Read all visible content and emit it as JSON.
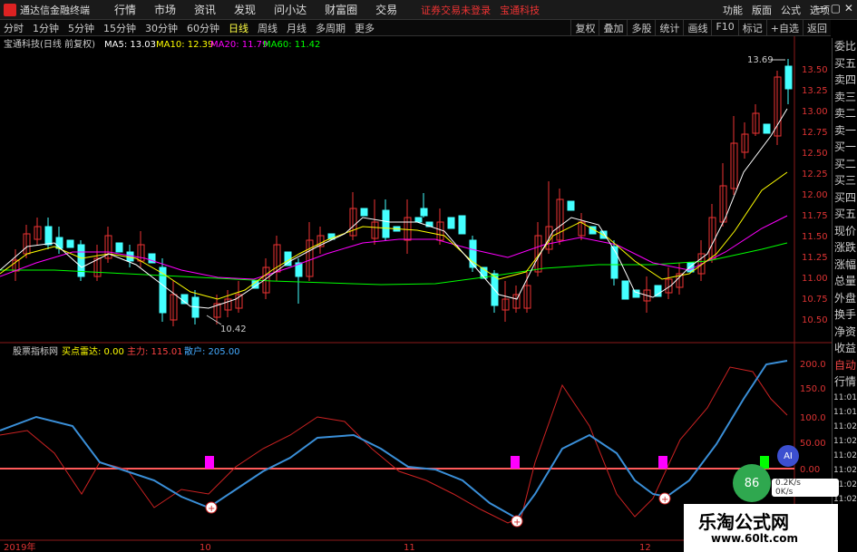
{
  "menu": {
    "app_title": "通达信金融终端",
    "items": [
      "行情",
      "市场",
      "资讯",
      "发现",
      "问小达",
      "财富圈",
      "交易"
    ],
    "status_login": "证券交易未登录",
    "status_stock": "宝通科技",
    "right_items": [
      "功能",
      "版面",
      "公式",
      "选项"
    ]
  },
  "toolbar": {
    "periods": [
      "分时",
      "1分钟",
      "5分钟",
      "15分钟",
      "30分钟",
      "60分钟",
      "日线",
      "周线",
      "月线",
      "多周期",
      "更多"
    ],
    "active": "日线",
    "right": [
      "复权",
      "叠加",
      "多股",
      "统计",
      "画线",
      "F10",
      "标记",
      "+自选",
      "返回"
    ]
  },
  "main_header": {
    "title": "宝通科技(日线 前复权)",
    "ma5": "MA5: 13.03",
    "ma10": "MA10: 12.39",
    "ma20": "MA20: 11.79",
    "ma60": "MA60: 11.42",
    "colors": {
      "ma5": "#ffffff",
      "ma10": "#ffff00",
      "ma20": "#ff00ff",
      "ma60": "#00ff00"
    }
  },
  "price_axis": [
    "13.50",
    "13.25",
    "13.00",
    "12.75",
    "12.50",
    "12.25",
    "12.00",
    "11.75",
    "11.50",
    "11.25",
    "11.00",
    "10.75",
    "10.50"
  ],
  "annotations": {
    "high": "13.69",
    "low": "10.42"
  },
  "indicator_header": {
    "name": "股票指标网",
    "line1": "买点雷达: 0.00",
    "line2": "主力: 115.01",
    "line3": "散户: 205.00"
  },
  "indicator_axis": [
    "200.0",
    "150.0",
    "100.0",
    "50.00",
    "0.00"
  ],
  "time_axis": [
    "2019年",
    "10",
    "11",
    "12"
  ],
  "side_panel": [
    "委比",
    "买五",
    "卖四",
    "卖三",
    "卖二",
    "卖一",
    "买一",
    "买二",
    "买三",
    "买四",
    "买五",
    "现价",
    "涨跌",
    "涨幅",
    "总量",
    "外盘",
    "换手",
    "净资",
    "收益"
  ],
  "side_panel_lower": [
    "自动",
    "行情"
  ],
  "right_clock": [
    "11:01",
    "11:01",
    "11:02",
    "11:02",
    "11:02",
    "11:02",
    "11:02",
    "11:02"
  ],
  "widgets": {
    "score": "86",
    "ai": "AI",
    "speed_up": "0.2K/s",
    "speed_down": "0K/s"
  },
  "watermark": {
    "title": "乐淘公式网",
    "url": "www.60lt.com"
  }
}
